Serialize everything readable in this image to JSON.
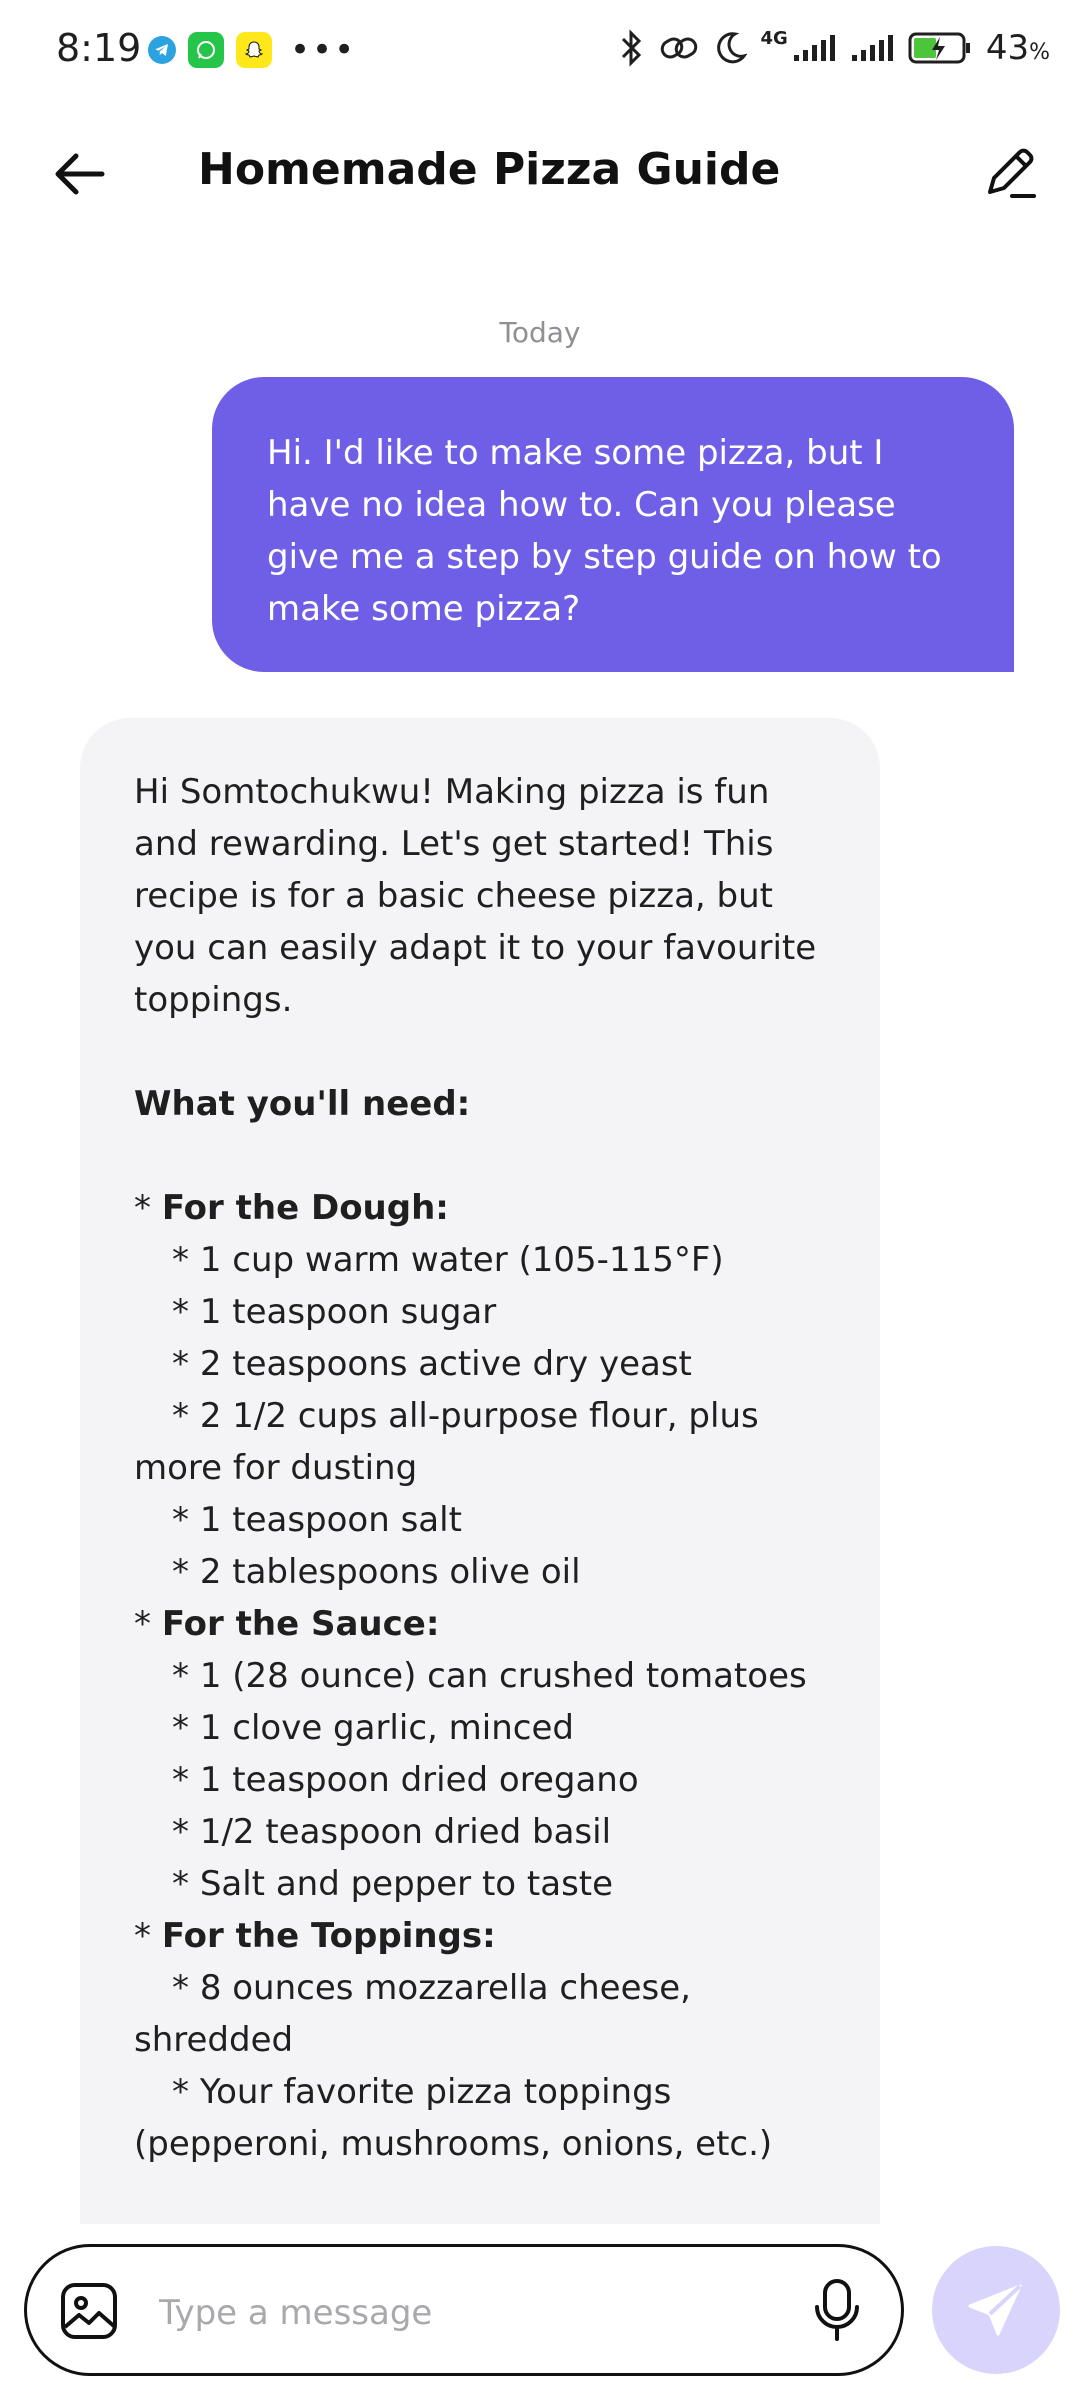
{
  "status_bar": {
    "time": "8:19",
    "network": "4G",
    "battery_percent": "43",
    "battery_unit": "%"
  },
  "header": {
    "title": "Homemade Pizza Guide"
  },
  "chat": {
    "date_label": "Today",
    "user_message": "Hi. I'd like to make some pizza, but I have no idea how to. Can you please give me a step by step guide on how to make some pizza?",
    "bot_message": {
      "intro": "Hi Somtochukwu!  Making pizza is fun and rewarding.  Let's get started!  This recipe is for a basic cheese pizza, but you can easily adapt it to your favourite toppings.",
      "need_heading": "What you'll need:",
      "dough_heading": "For the Dough:",
      "dough_items": [
        "1 cup warm water (105-115°F)",
        "1 teaspoon sugar",
        "2 teaspoons active dry yeast",
        "2 1/2 cups all-purpose flour, plus more for dusting",
        "1 teaspoon salt",
        "2 tablespoons olive oil"
      ],
      "sauce_heading": "For the Sauce:",
      "sauce_items": [
        "1 (28 ounce) can crushed tomatoes",
        "1 clove garlic, minced",
        "1 teaspoon dried oregano",
        "1/2 teaspoon dried basil",
        "Salt and pepper to taste"
      ],
      "toppings_heading": "For the Toppings:",
      "toppings_items": [
        "8 ounces mozzarella cheese, shredded",
        "Your favorite pizza toppings (pepperoni, mushrooms, onions, etc.)"
      ]
    }
  },
  "composer": {
    "placeholder": "Type a message"
  },
  "colors": {
    "accent": "#6f5fe6",
    "bot_bubble": "#f4f4f6",
    "send_disabled": "#d9d4fb"
  },
  "icons": {
    "back": "arrow-left-icon",
    "edit": "pencil-icon",
    "attach": "image-icon",
    "mic": "microphone-icon",
    "send": "paper-plane-icon"
  }
}
